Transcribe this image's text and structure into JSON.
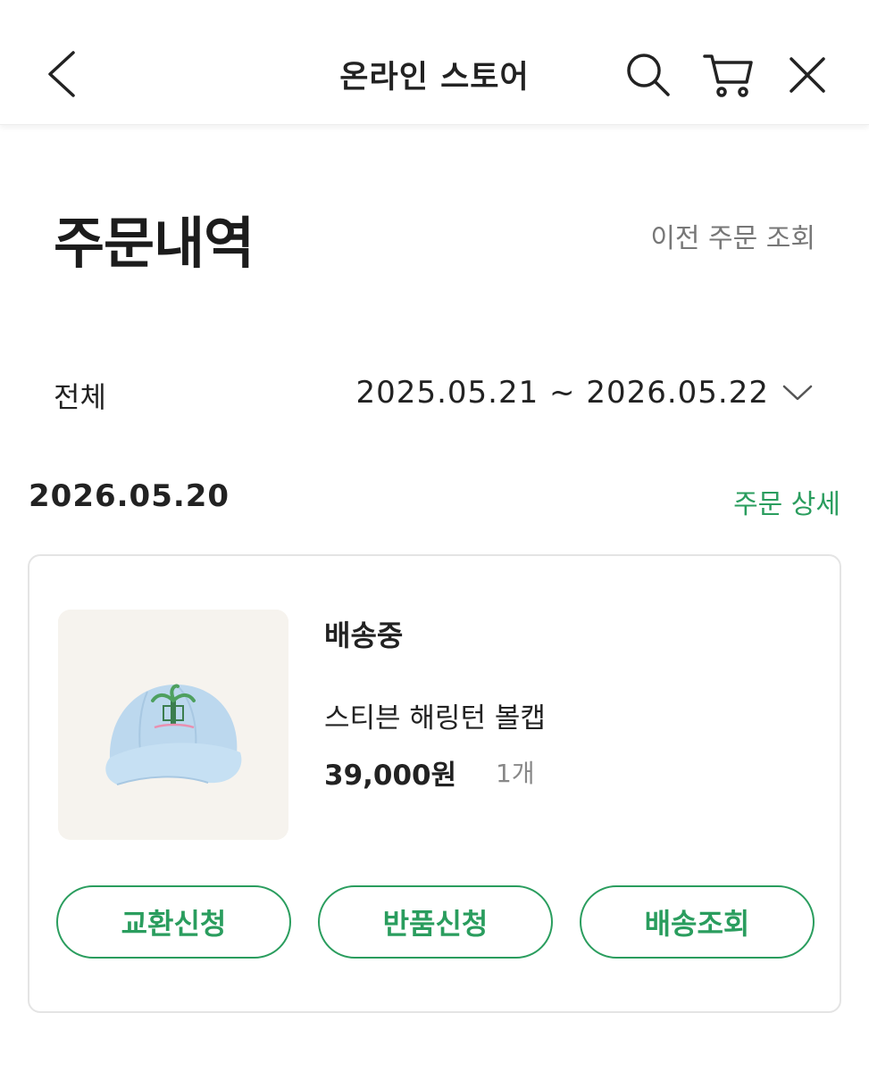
{
  "header": {
    "title": "온라인 스토어",
    "icons": [
      "chevron-left-icon",
      "search-icon",
      "cart-icon",
      "close-icon"
    ]
  },
  "page": {
    "title": "주문내역",
    "prev_orders_link": "이전 주문 조회"
  },
  "filter": {
    "status": "전체",
    "date_range": "2025.05.21 ~ 2026.05.22"
  },
  "order": {
    "date": "2026.05.20",
    "detail_link": "주문 상세",
    "status": "배송중",
    "product_name": "스티븐 해링턴 볼캡",
    "price": "39,000원",
    "quantity": "1개",
    "buttons": {
      "exchange": "교환신청",
      "return": "반품신청",
      "tracking": "배송조회"
    }
  },
  "colors": {
    "accent": "#2a9d5e",
    "text": "#222222",
    "muted": "#777777",
    "card_border": "#e4e4e4"
  }
}
